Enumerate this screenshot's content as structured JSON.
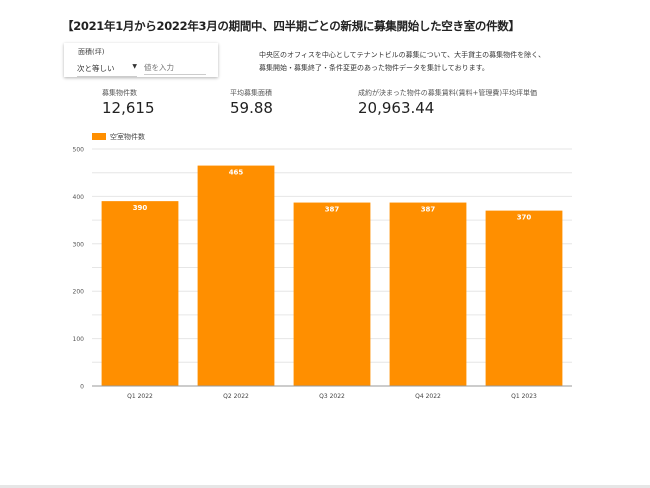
{
  "title": "【2021年1月から2022年3月の期間中、四半期ごとの新規に募集開始した空き室の件数】",
  "filter": {
    "label": "面積(坪)",
    "operator": "次と等しい",
    "value": "",
    "placeholder": "値を入力"
  },
  "description": [
    "中央区のオフィスを中心としてテナントビルの募集について、大手貸主の募集物件を除く、",
    "募集開始・募集終了・条件変更のあった物件データを集計しております。"
  ],
  "kpis": [
    {
      "label": "募集物件数",
      "value": "12,615"
    },
    {
      "label": "平均募集面積",
      "value": "59.88"
    },
    {
      "label": "成約が決まった物件の募集賃料(賃料+管理費)平均坪単価",
      "value": "20,963.44"
    }
  ],
  "colors": {
    "bar": "#ff8f00",
    "grid": "#e6e6e6",
    "axis": "#999999"
  },
  "chart_data": {
    "type": "bar",
    "categories": [
      "Q1 2022",
      "Q2 2022",
      "Q3 2022",
      "Q4 2022",
      "Q1 2023"
    ],
    "series": [
      {
        "name": "空室物件数",
        "values": [
          390,
          465,
          387,
          387,
          370
        ]
      }
    ],
    "ylim": [
      0,
      500
    ],
    "yticks": [
      0,
      100,
      200,
      300,
      400,
      500
    ],
    "grid": true,
    "legend": "top-left",
    "xlabel": "",
    "ylabel": ""
  }
}
